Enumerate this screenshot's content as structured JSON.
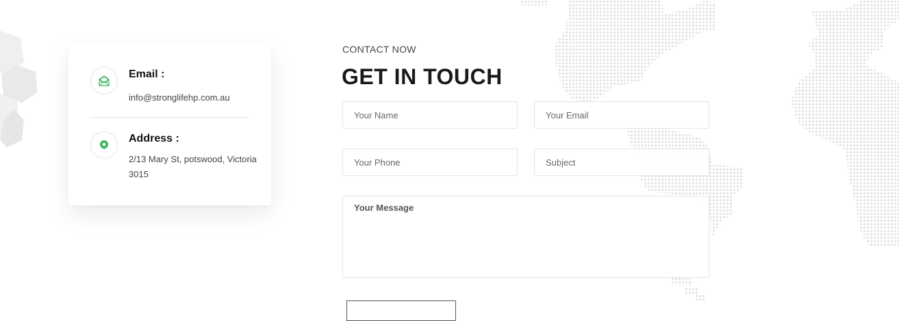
{
  "contact_card": {
    "email": {
      "icon": "envelope-icon",
      "title": "Email :",
      "value": "info@stronglifehp.com.au"
    },
    "address": {
      "icon": "map-pin-icon",
      "title": "Address :",
      "value": "2/13 Mary St, potswood, Victoria 3015"
    }
  },
  "heading": {
    "eyebrow": "CONTACT NOW",
    "title": "GET IN TOUCH"
  },
  "form": {
    "name_placeholder": "Your Name",
    "email_placeholder": "Your Email",
    "phone_placeholder": "Your Phone",
    "subject_placeholder": "Subject",
    "message_placeholder": "Your Message"
  },
  "colors": {
    "accent_green": "#3cb35a",
    "map_dots": "#e3e3e3",
    "hexagon": "#ededed"
  }
}
